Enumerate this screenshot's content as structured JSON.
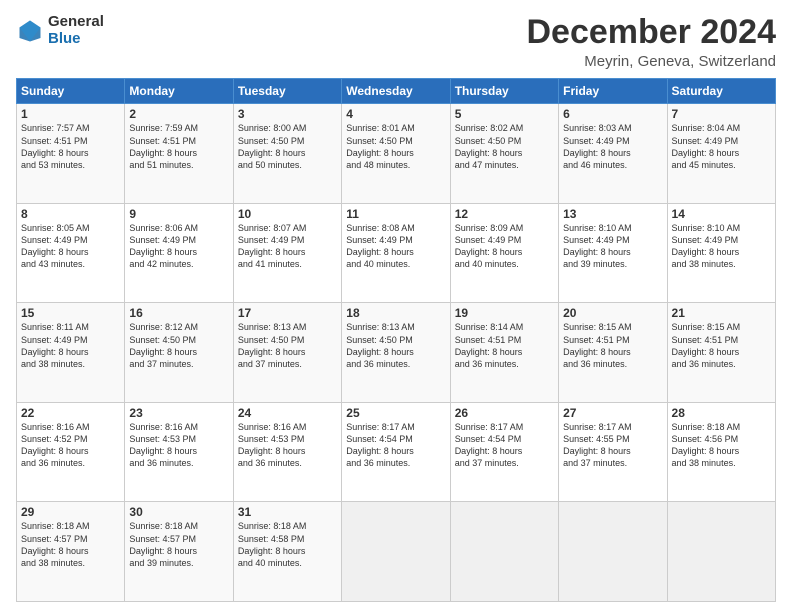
{
  "logo": {
    "general": "General",
    "blue": "Blue"
  },
  "header": {
    "month": "December 2024",
    "location": "Meyrin, Geneva, Switzerland"
  },
  "weekdays": [
    "Sunday",
    "Monday",
    "Tuesday",
    "Wednesday",
    "Thursday",
    "Friday",
    "Saturday"
  ],
  "weeks": [
    [
      {
        "day": "1",
        "sunrise": "7:57 AM",
        "sunset": "4:51 PM",
        "daylight": "8 hours and 53 minutes."
      },
      {
        "day": "2",
        "sunrise": "7:59 AM",
        "sunset": "4:51 PM",
        "daylight": "8 hours and 51 minutes."
      },
      {
        "day": "3",
        "sunrise": "8:00 AM",
        "sunset": "4:50 PM",
        "daylight": "8 hours and 50 minutes."
      },
      {
        "day": "4",
        "sunrise": "8:01 AM",
        "sunset": "4:50 PM",
        "daylight": "8 hours and 48 minutes."
      },
      {
        "day": "5",
        "sunrise": "8:02 AM",
        "sunset": "4:50 PM",
        "daylight": "8 hours and 47 minutes."
      },
      {
        "day": "6",
        "sunrise": "8:03 AM",
        "sunset": "4:49 PM",
        "daylight": "8 hours and 46 minutes."
      },
      {
        "day": "7",
        "sunrise": "8:04 AM",
        "sunset": "4:49 PM",
        "daylight": "8 hours and 45 minutes."
      }
    ],
    [
      {
        "day": "8",
        "sunrise": "8:05 AM",
        "sunset": "4:49 PM",
        "daylight": "8 hours and 43 minutes."
      },
      {
        "day": "9",
        "sunrise": "8:06 AM",
        "sunset": "4:49 PM",
        "daylight": "8 hours and 42 minutes."
      },
      {
        "day": "10",
        "sunrise": "8:07 AM",
        "sunset": "4:49 PM",
        "daylight": "8 hours and 41 minutes."
      },
      {
        "day": "11",
        "sunrise": "8:08 AM",
        "sunset": "4:49 PM",
        "daylight": "8 hours and 40 minutes."
      },
      {
        "day": "12",
        "sunrise": "8:09 AM",
        "sunset": "4:49 PM",
        "daylight": "8 hours and 40 minutes."
      },
      {
        "day": "13",
        "sunrise": "8:10 AM",
        "sunset": "4:49 PM",
        "daylight": "8 hours and 39 minutes."
      },
      {
        "day": "14",
        "sunrise": "8:10 AM",
        "sunset": "4:49 PM",
        "daylight": "8 hours and 38 minutes."
      }
    ],
    [
      {
        "day": "15",
        "sunrise": "8:11 AM",
        "sunset": "4:49 PM",
        "daylight": "8 hours and 38 minutes."
      },
      {
        "day": "16",
        "sunrise": "8:12 AM",
        "sunset": "4:50 PM",
        "daylight": "8 hours and 37 minutes."
      },
      {
        "day": "17",
        "sunrise": "8:13 AM",
        "sunset": "4:50 PM",
        "daylight": "8 hours and 37 minutes."
      },
      {
        "day": "18",
        "sunrise": "8:13 AM",
        "sunset": "4:50 PM",
        "daylight": "8 hours and 36 minutes."
      },
      {
        "day": "19",
        "sunrise": "8:14 AM",
        "sunset": "4:51 PM",
        "daylight": "8 hours and 36 minutes."
      },
      {
        "day": "20",
        "sunrise": "8:15 AM",
        "sunset": "4:51 PM",
        "daylight": "8 hours and 36 minutes."
      },
      {
        "day": "21",
        "sunrise": "8:15 AM",
        "sunset": "4:51 PM",
        "daylight": "8 hours and 36 minutes."
      }
    ],
    [
      {
        "day": "22",
        "sunrise": "8:16 AM",
        "sunset": "4:52 PM",
        "daylight": "8 hours and 36 minutes."
      },
      {
        "day": "23",
        "sunrise": "8:16 AM",
        "sunset": "4:53 PM",
        "daylight": "8 hours and 36 minutes."
      },
      {
        "day": "24",
        "sunrise": "8:16 AM",
        "sunset": "4:53 PM",
        "daylight": "8 hours and 36 minutes."
      },
      {
        "day": "25",
        "sunrise": "8:17 AM",
        "sunset": "4:54 PM",
        "daylight": "8 hours and 36 minutes."
      },
      {
        "day": "26",
        "sunrise": "8:17 AM",
        "sunset": "4:54 PM",
        "daylight": "8 hours and 37 minutes."
      },
      {
        "day": "27",
        "sunrise": "8:17 AM",
        "sunset": "4:55 PM",
        "daylight": "8 hours and 37 minutes."
      },
      {
        "day": "28",
        "sunrise": "8:18 AM",
        "sunset": "4:56 PM",
        "daylight": "8 hours and 38 minutes."
      }
    ],
    [
      {
        "day": "29",
        "sunrise": "8:18 AM",
        "sunset": "4:57 PM",
        "daylight": "8 hours and 38 minutes."
      },
      {
        "day": "30",
        "sunrise": "8:18 AM",
        "sunset": "4:57 PM",
        "daylight": "8 hours and 39 minutes."
      },
      {
        "day": "31",
        "sunrise": "8:18 AM",
        "sunset": "4:58 PM",
        "daylight": "8 hours and 40 minutes."
      },
      null,
      null,
      null,
      null
    ]
  ],
  "labels": {
    "sunrise": "Sunrise:",
    "sunset": "Sunset:",
    "daylight": "Daylight:"
  }
}
